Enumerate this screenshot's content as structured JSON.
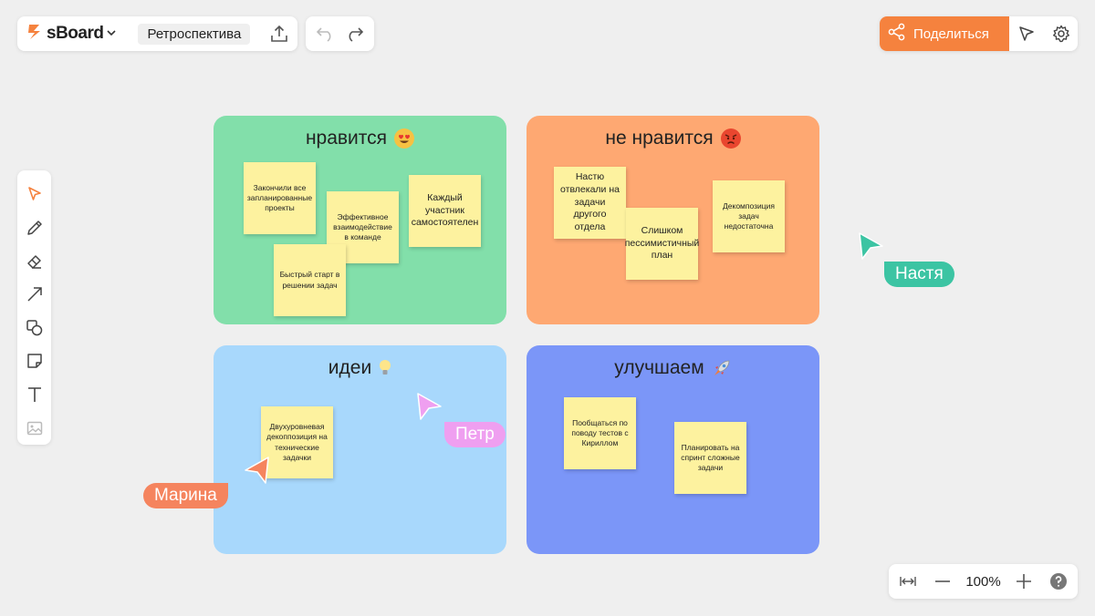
{
  "app": {
    "logo": "sBoard",
    "board_title": "Ретроспектива"
  },
  "header": {
    "share_label": "Поделиться"
  },
  "tools": [
    "select-icon",
    "pen-icon",
    "eraser-icon",
    "arrow-icon",
    "shapes-icon",
    "sticky-note-icon",
    "text-icon",
    "image-icon"
  ],
  "zoom": {
    "level": "100%"
  },
  "colors": {
    "accent": "#f5823e",
    "likes": "#82dfaa",
    "dislikes": "#fea872",
    "ideas": "#a8d8fc",
    "improve": "#7b96f8",
    "sticky": "#fdf29f"
  },
  "quadrants": {
    "likes": {
      "title": "нравится",
      "notes": [
        "Закончили все запланированные проекты",
        "Эффективное взаимодействие в команде",
        "Каждый участник самостоятелен",
        "Быстрый старт в решении задач"
      ]
    },
    "dislikes": {
      "title": "не нравится",
      "notes": [
        "Настю отвлекали на задачи другого отдела",
        "Слишком пессимистичный план",
        "Декомпозиция задач недостаточна"
      ]
    },
    "ideas": {
      "title": "идеи",
      "notes": [
        "Двухуровневая декоппозиция на технические задачки"
      ]
    },
    "improve": {
      "title": "улучшаем",
      "notes": [
        "Пообщаться по поводу тестов с Кириллом",
        "Планировать на спринт сложные задачи"
      ]
    }
  },
  "collaborators": [
    {
      "name": "Настя",
      "color": "#3cc4a3"
    },
    {
      "name": "Петр",
      "color": "#ef9ff0"
    },
    {
      "name": "Марина",
      "color": "#f5845e"
    }
  ]
}
